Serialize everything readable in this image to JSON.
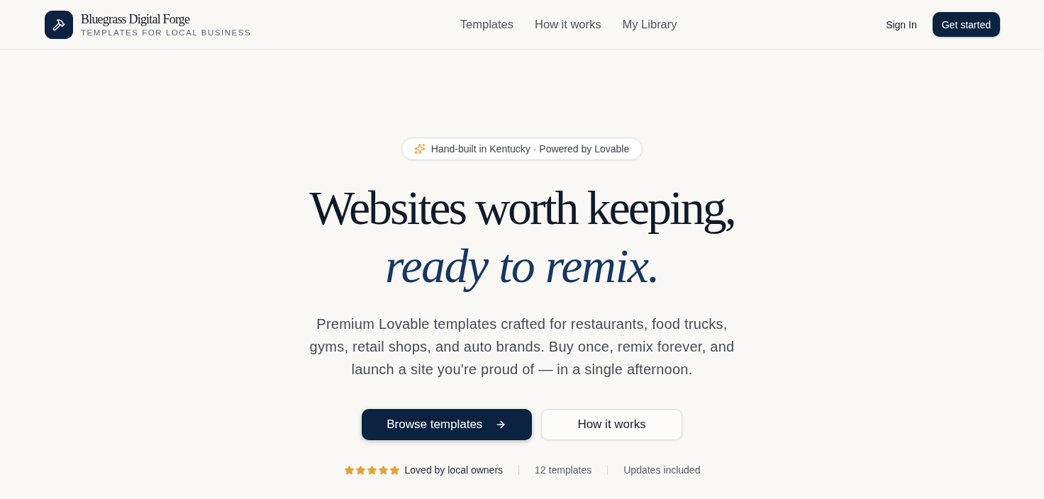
{
  "header": {
    "brand": {
      "name": "Bluegrass Digital Forge",
      "tagline": "TEMPLATES FOR LOCAL BUSINESS"
    },
    "nav": [
      {
        "label": "Templates"
      },
      {
        "label": "How it works"
      },
      {
        "label": "My Library"
      }
    ],
    "sign_in": "Sign In",
    "cta": "Get started"
  },
  "hero": {
    "badge": "Hand-built in Kentucky · Powered by Lovable",
    "title": "Websites worth keeping,",
    "title_accent": "ready to remix.",
    "description": "Premium Lovable templates crafted for restaurants, food trucks, gyms, retail shops, and auto brands. Buy once, remix forever, and launch a site you're proud of — in a single afternoon.",
    "buttons": [
      {
        "label": "Browse templates",
        "kind": "primary"
      },
      {
        "label": "How it works",
        "kind": "secondary"
      }
    ],
    "trust": {
      "stars": 5,
      "rating_label": "Loved by local owners",
      "facts": [
        "12 templates",
        "Updates included"
      ]
    }
  }
}
